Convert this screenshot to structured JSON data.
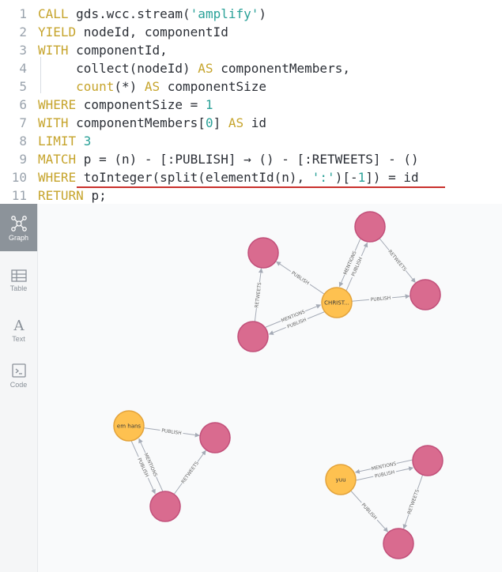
{
  "editor": {
    "line_numbers": [
      "1",
      "2",
      "3",
      "4",
      "5",
      "6",
      "7",
      "8",
      "9",
      "10",
      "11"
    ],
    "lines": [
      [
        {
          "t": "CALL ",
          "c": "kw"
        },
        {
          "t": "gds.wcc.stream(",
          "c": "fn"
        },
        {
          "t": "'amplify'",
          "c": "str"
        },
        {
          "t": ")",
          "c": "fn"
        }
      ],
      [
        {
          "t": "YIELD ",
          "c": "kw"
        },
        {
          "t": "nodeId, componentId",
          "c": "fn"
        }
      ],
      [
        {
          "t": "WITH ",
          "c": "kw"
        },
        {
          "t": "componentId,",
          "c": "fn"
        }
      ],
      [
        {
          "t": "     collect(nodeId) ",
          "c": "fn"
        },
        {
          "t": "AS ",
          "c": "kw"
        },
        {
          "t": "componentMembers,",
          "c": "fn"
        }
      ],
      [
        {
          "t": "     count",
          "c": "kw"
        },
        {
          "t": "(*) ",
          "c": "fn"
        },
        {
          "t": "AS ",
          "c": "kw"
        },
        {
          "t": "componentSize",
          "c": "fn"
        }
      ],
      [
        {
          "t": "WHERE ",
          "c": "kw"
        },
        {
          "t": "componentSize = ",
          "c": "fn"
        },
        {
          "t": "1",
          "c": "num"
        }
      ],
      [
        {
          "t": "WITH ",
          "c": "kw"
        },
        {
          "t": "componentMembers[",
          "c": "fn"
        },
        {
          "t": "0",
          "c": "num"
        },
        {
          "t": "] ",
          "c": "fn"
        },
        {
          "t": "AS ",
          "c": "kw"
        },
        {
          "t": "id",
          "c": "fn"
        }
      ],
      [
        {
          "t": "LIMIT ",
          "c": "kw"
        },
        {
          "t": "3",
          "c": "num"
        }
      ],
      [
        {
          "t": "MATCH ",
          "c": "kw"
        },
        {
          "t": "p = (n) - [:PUBLISH] → () - [:RETWEETS] - ()",
          "c": "fn"
        }
      ],
      [
        {
          "t": "WHERE ",
          "c": "kw"
        },
        {
          "t": "toInteger(split(elementId(n), ",
          "c": "fn"
        },
        {
          "t": "':'",
          "c": "str"
        },
        {
          "t": ")[-",
          "c": "fn"
        },
        {
          "t": "1",
          "c": "num"
        },
        {
          "t": "]) = id",
          "c": "fn"
        }
      ],
      [
        {
          "t": "RETURN ",
          "c": "kw"
        },
        {
          "t": "p;",
          "c": "fn"
        }
      ]
    ]
  },
  "sidebar": {
    "items": [
      {
        "label": "Graph",
        "icon": "graph-icon",
        "active": true
      },
      {
        "label": "Table",
        "icon": "table-icon",
        "active": false
      },
      {
        "label": "Text",
        "icon": "text-icon",
        "active": false
      },
      {
        "label": "Code",
        "icon": "code-icon",
        "active": false
      }
    ]
  },
  "graph": {
    "colors": {
      "pink": "#d96b8f",
      "pink_stroke": "#c2507a",
      "orange": "#fec150",
      "orange_stroke": "#e3a33b",
      "edge": "#a5abb6"
    },
    "nodes": [
      {
        "id": "c1",
        "label": "CHRIST...",
        "type": "orange"
      },
      {
        "id": "p1",
        "label": "",
        "type": "pink"
      },
      {
        "id": "p2",
        "label": "",
        "type": "pink"
      },
      {
        "id": "p3",
        "label": "",
        "type": "pink"
      },
      {
        "id": "p4",
        "label": "",
        "type": "pink"
      },
      {
        "id": "c2",
        "label": "em hans",
        "type": "orange"
      },
      {
        "id": "p5",
        "label": "",
        "type": "pink"
      },
      {
        "id": "p6",
        "label": "",
        "type": "pink"
      },
      {
        "id": "c3",
        "label": "yuu",
        "type": "orange"
      },
      {
        "id": "p7",
        "label": "",
        "type": "pink"
      },
      {
        "id": "p8",
        "label": "",
        "type": "pink"
      }
    ],
    "edges": [
      {
        "from": "c1",
        "to": "p1",
        "label": "PUBLISH"
      },
      {
        "from": "p4",
        "to": "p1",
        "label": "RETWEETS"
      },
      {
        "from": "p4",
        "to": "c1",
        "label": "MENTIONS"
      },
      {
        "from": "c1",
        "to": "p4",
        "label": "PUBLISH"
      },
      {
        "from": "c1",
        "to": "p2",
        "label": "PUBLISH"
      },
      {
        "from": "p2",
        "to": "c1",
        "label": "MENTIONS"
      },
      {
        "from": "p2",
        "to": "p3",
        "label": "RETWEETS"
      },
      {
        "from": "c1",
        "to": "p3",
        "label": "PUBLISH"
      },
      {
        "from": "c2",
        "to": "p5",
        "label": "PUBLISH"
      },
      {
        "from": "c2",
        "to": "p6",
        "label": "PUBLISH"
      },
      {
        "from": "p6",
        "to": "c2",
        "label": "MENTIONS"
      },
      {
        "from": "p6",
        "to": "p5",
        "label": "RETWEETS"
      },
      {
        "from": "c3",
        "to": "p7",
        "label": "PUBLISH"
      },
      {
        "from": "p7",
        "to": "c3",
        "label": "MENTIONS"
      },
      {
        "from": "c3",
        "to": "p8",
        "label": "PUBLISH"
      },
      {
        "from": "p7",
        "to": "p8",
        "label": "RETWEETS"
      }
    ]
  }
}
